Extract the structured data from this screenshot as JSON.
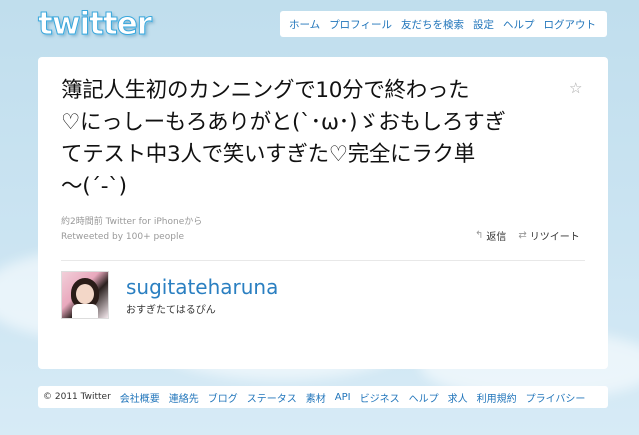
{
  "logo": "twitter",
  "nav": {
    "home": "ホーム",
    "profile": "プロフィール",
    "find_friends": "友だちを検索",
    "settings": "設定",
    "help": "ヘルプ",
    "logout": "ログアウト"
  },
  "tweet": {
    "line1": "簿記人生初のカンニングで10分で終わった",
    "line2": "♡にっしーもろありがと(`･ω･)ゞおもしろすぎ",
    "line3": "てテスト中3人で笑いすぎた♡完全にラク単",
    "line4": "～(´-`)",
    "meta": "約2時間前 Twitter for iPhoneから",
    "retweeted": "Retweeted by 100+ people",
    "reply_label": "返信",
    "retweet_label": "リツイート"
  },
  "user": {
    "screen_name": "sugitateharuna",
    "name": "おすぎたてはるぴん"
  },
  "footer": {
    "copyright": "© 2011 Twitter",
    "links": [
      "会社概要",
      "連絡先",
      "ブログ",
      "ステータス",
      "素材",
      "API",
      "ビジネス",
      "ヘルプ",
      "求人",
      "利用規約",
      "プライバシー"
    ]
  },
  "icons": {
    "star": "star-icon",
    "reply": "reply-icon",
    "retweet": "retweet-icon"
  },
  "colors": {
    "background": "#c0deed",
    "link": "#2276bb",
    "username": "#2a7fc1"
  }
}
